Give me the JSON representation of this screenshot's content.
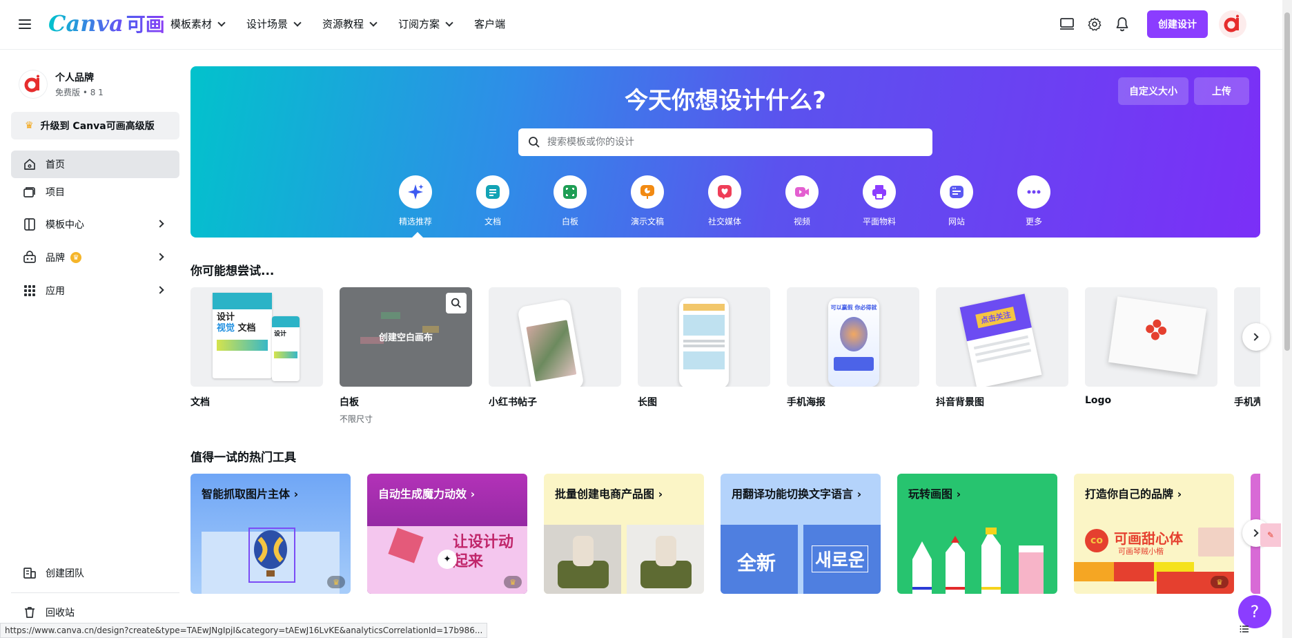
{
  "topbar": {
    "logo_en": "Canva",
    "logo_cn": "可画",
    "nav": [
      "模板素材",
      "设计场景",
      "资源教程",
      "订阅方案",
      "客户端"
    ],
    "create_label": "创建设计"
  },
  "sidebar": {
    "brand_name": "个人品牌",
    "brand_sub": "免费版 • 8 1",
    "upgrade_label": "升级到 Canva可画高级版",
    "items": [
      {
        "label": "首页"
      },
      {
        "label": "项目"
      },
      {
        "label": "模板中心"
      },
      {
        "label": "品牌"
      },
      {
        "label": "应用"
      }
    ],
    "bottom_items": [
      {
        "label": "创建团队"
      },
      {
        "label": "回收站"
      }
    ]
  },
  "hero": {
    "title": "今天你想设计什么?",
    "custom_size": "自定义大小",
    "upload": "上传",
    "search_placeholder": "搜索模板或你的设计",
    "categories": [
      {
        "label": "精选推荐",
        "icon": "sparkle-icon",
        "color": "#3d5af1"
      },
      {
        "label": "文档",
        "icon": "doc-icon",
        "color": "#13a3b5"
      },
      {
        "label": "白板",
        "icon": "whiteboard-icon",
        "color": "#1f9e55"
      },
      {
        "label": "演示文稿",
        "icon": "presentation-icon",
        "color": "#f28a12"
      },
      {
        "label": "社交媒体",
        "icon": "heart-icon",
        "color": "#ef3e58"
      },
      {
        "label": "视频",
        "icon": "video-icon",
        "color": "#e35fd0"
      },
      {
        "label": "平面物料",
        "icon": "print-icon",
        "color": "#8b3dff"
      },
      {
        "label": "网站",
        "icon": "website-icon",
        "color": "#5a58f2"
      },
      {
        "label": "更多",
        "icon": "more-icon",
        "color": "#6f42f5"
      }
    ]
  },
  "try_section": {
    "title": "你可能想尝试...",
    "cards": [
      {
        "label": "文档",
        "sub": ""
      },
      {
        "label": "白板",
        "sub": "不限尺寸",
        "overlay": "创建空白画布"
      },
      {
        "label": "小红书帖子",
        "sub": ""
      },
      {
        "label": "长图",
        "sub": ""
      },
      {
        "label": "手机海报",
        "sub": ""
      },
      {
        "label": "抖音背景图",
        "sub": ""
      },
      {
        "label": "Logo",
        "sub": ""
      },
      {
        "label": "手机壳",
        "sub": ""
      }
    ],
    "thumb_text": {
      "doc_line1": "设计",
      "doc_line2": "视觉",
      "doc_line3": "文档",
      "poster_text": "可以赢假 你必得就",
      "douyin_text": "点击关注"
    }
  },
  "tools_section": {
    "title": "值得一试的热门工具",
    "tools": [
      {
        "label": "智能抓取图片主体 ›",
        "bg": "#6aa2f5"
      },
      {
        "label": "自动生成魔力动效 ›",
        "bg": "#a52fb8",
        "art": "让设计动起来"
      },
      {
        "label": "批量创建电商产品图 ›",
        "bg": "#fbf5c6"
      },
      {
        "label": "用翻译功能切换文字语言 ›",
        "bg": "#b4d3fb",
        "art_left": "全新",
        "art_right": "새로운"
      },
      {
        "label": "玩转画图 ›",
        "bg": "#27c46f"
      },
      {
        "label": "打造你自己的品牌 ›",
        "bg": "#fbf5c6",
        "art": "可画甜心体",
        "art_sub": "可画琴贼小楷"
      }
    ]
  },
  "statusbar": {
    "url": "https://www.canva.cn/design?create&type=TAEwJNgIpjI&category=tAEwJ16LvKE&analyticsCorrelationId=17b986..."
  },
  "help_label": "?"
}
